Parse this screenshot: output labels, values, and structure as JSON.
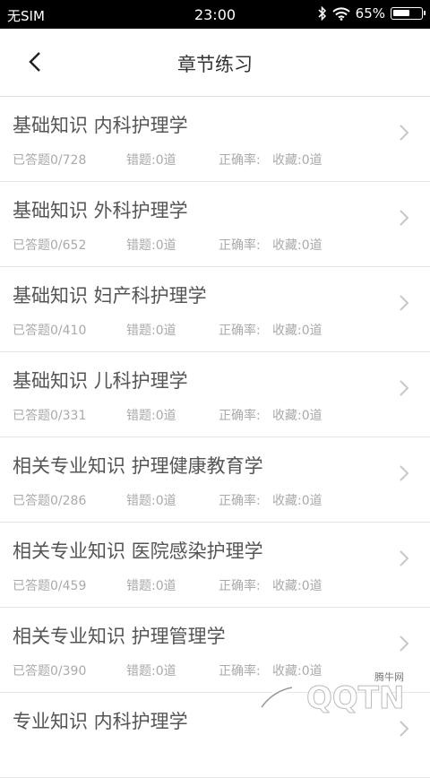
{
  "status_bar": {
    "carrier": "无SIM",
    "time": "23:00",
    "battery": "65%",
    "battery_level": 0.65
  },
  "header": {
    "title": "章节练习",
    "back_icon": "chevron-left-icon"
  },
  "items": [
    {
      "name": "基础知识 内科护理学",
      "answered": "已答题0/728",
      "errors": "错题:0道",
      "accuracy": "正确率:",
      "favorites": "收藏:0道"
    },
    {
      "name": "基础知识 外科护理学",
      "answered": "已答题0/652",
      "errors": "错题:0道",
      "accuracy": "正确率:",
      "favorites": "收藏:0道"
    },
    {
      "name": "基础知识 妇产科护理学",
      "answered": "已答题0/410",
      "errors": "错题:0道",
      "accuracy": "正确率:",
      "favorites": "收藏:0道"
    },
    {
      "name": "基础知识 儿科护理学",
      "answered": "已答题0/331",
      "errors": "错题:0道",
      "accuracy": "正确率:",
      "favorites": "收藏:0道"
    },
    {
      "name": "相关专业知识 护理健康教育学",
      "answered": "已答题0/286",
      "errors": "错题:0道",
      "accuracy": "正确率:",
      "favorites": "收藏:0道"
    },
    {
      "name": "相关专业知识 医院感染护理学",
      "answered": "已答题0/459",
      "errors": "错题:0道",
      "accuracy": "正确率:",
      "favorites": "收藏:0道"
    },
    {
      "name": "相关专业知识 护理管理学",
      "answered": "已答题0/390",
      "errors": "错题:0道",
      "accuracy": "正确率:",
      "favorites": "收藏:0道"
    },
    {
      "name": "专业知识 内科护理学",
      "answered": "",
      "errors": "",
      "accuracy": "",
      "favorites": ""
    }
  ],
  "watermark": {
    "site": "QQTN",
    "sub": "腾牛网"
  }
}
